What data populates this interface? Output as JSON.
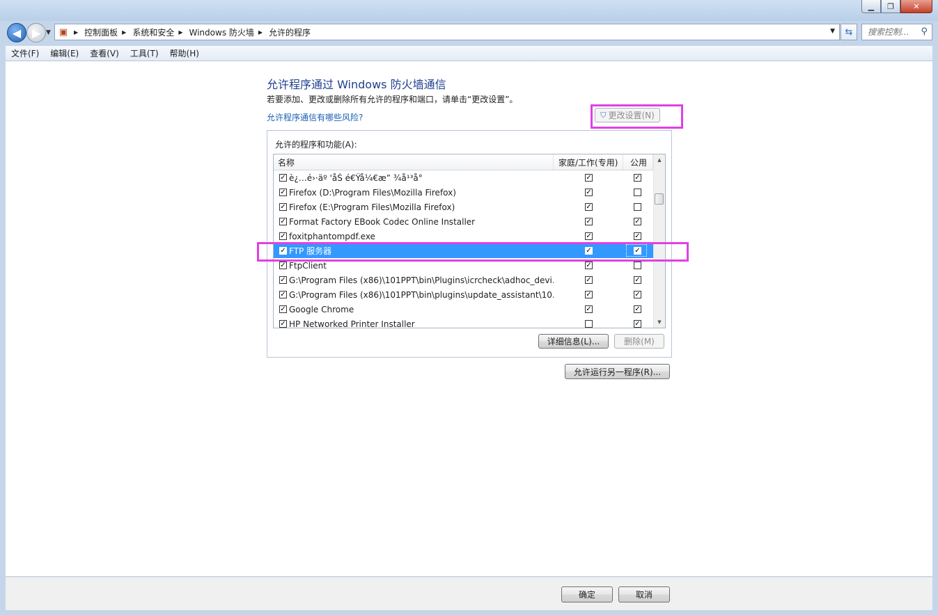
{
  "window": {
    "caption_buttons": [
      "minimize-icon",
      "maximize-icon",
      "close-icon"
    ]
  },
  "address_bar": {
    "root_icon": "control-panel-icon",
    "breadcrumbs": [
      "控制面板",
      "系统和安全",
      "Windows 防火墙",
      "允许的程序"
    ]
  },
  "search": {
    "placeholder": "搜索控制..."
  },
  "menu": [
    "文件(F)",
    "编辑(E)",
    "查看(V)",
    "工具(T)",
    "帮助(H)"
  ],
  "page": {
    "title": "允许程序通过 Windows 防火墙通信",
    "description": "若要添加、更改或删除所有允许的程序和端口，请单击“更改设置”。",
    "risk_link": "允许程序通信有哪些风险?",
    "change_settings_button": "更改设置(N)"
  },
  "programs": {
    "group_label": "允许的程序和功能(A):",
    "columns": [
      "名称",
      "家庭/工作(专用)",
      "公用"
    ],
    "rows": [
      {
        "name": "è¿…é›·äº  'åŠ é€Ÿå¼€æ” ¾å¹³å°",
        "enabled": true,
        "home": true,
        "public": true
      },
      {
        "name": "Firefox (D:\\Program Files\\Mozilla Firefox)",
        "enabled": true,
        "home": true,
        "public": false
      },
      {
        "name": "Firefox (E:\\Program Files\\Mozilla Firefox)",
        "enabled": true,
        "home": true,
        "public": false
      },
      {
        "name": "Format Factory EBook Codec Online Installer",
        "enabled": true,
        "home": true,
        "public": true
      },
      {
        "name": "foxitphantompdf.exe",
        "enabled": true,
        "home": true,
        "public": true
      },
      {
        "name": "FTP 服务器",
        "enabled": true,
        "home": true,
        "public": true,
        "selected": true
      },
      {
        "name": "FtpClient",
        "enabled": true,
        "home": true,
        "public": false
      },
      {
        "name": "G:\\Program Files (x86)\\101PPT\\bin\\Plugins\\icrcheck\\adhoc_devi...",
        "enabled": true,
        "home": true,
        "public": true
      },
      {
        "name": "G:\\Program Files (x86)\\101PPT\\bin\\plugins\\update_assistant\\10...",
        "enabled": true,
        "home": true,
        "public": true
      },
      {
        "name": "Google Chrome",
        "enabled": true,
        "home": true,
        "public": true
      },
      {
        "name": "HP Networked Printer Installer",
        "enabled": true,
        "home": false,
        "public": true
      }
    ],
    "details_button": "详细信息(L)...",
    "remove_button": "删除(M)"
  },
  "allow_another_button": "允许运行另一程序(R)...",
  "footer": {
    "ok": "确定",
    "cancel": "取消"
  },
  "colors": {
    "highlight": "#e040e6",
    "selection": "#3399ff",
    "heading": "#1e3f8f",
    "link": "#1a5fb4"
  }
}
